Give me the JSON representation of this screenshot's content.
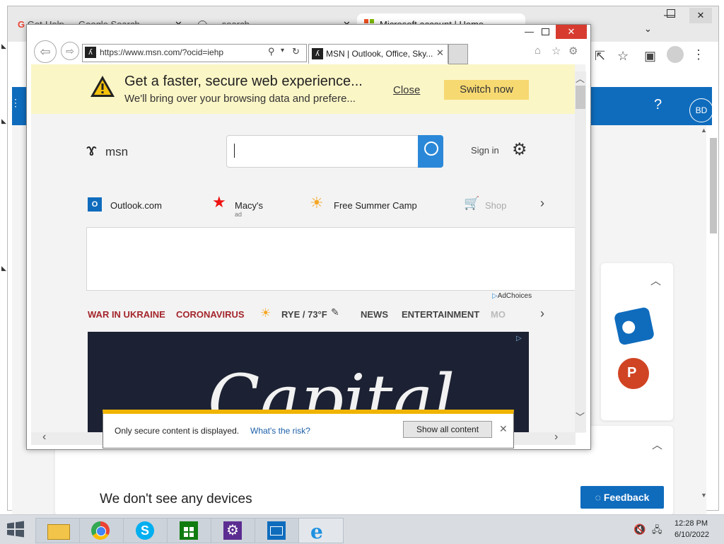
{
  "chrome": {
    "tabs": [
      {
        "label": "Get-Help … Google Search"
      },
      {
        "label": "… search …"
      },
      {
        "label": "Microsoft account | Home"
      }
    ],
    "help_label": "?",
    "avatar_initials": "BD",
    "devices_title": "We don't see any devices",
    "feedback_label": "Feedback"
  },
  "ie": {
    "address": "https://www.msn.com/?ocid=iehp",
    "tab_title": "MSN | Outlook, Office, Sky...",
    "yellow_bar": {
      "title": "Get a faster, secure web experience...",
      "subtitle": "We'll bring over your browsing data and prefere...",
      "close_label": "Close",
      "switch_label": "Switch now"
    },
    "msn": {
      "logo_text": "msn",
      "signin_label": "Sign in",
      "quick_links": [
        {
          "label": "Outlook.com"
        },
        {
          "label": "Macy's",
          "sublabel": "ad"
        },
        {
          "label": "Free Summer Camp"
        },
        {
          "label": "Shop"
        }
      ],
      "adchoices_label": "AdChoices",
      "nav_categories": [
        {
          "label": "WAR IN UKRAINE",
          "color": "#a4262c"
        },
        {
          "label": "CORONAVIRUS",
          "color": "#a4262c"
        },
        {
          "label": "RYE / 73°F",
          "color": "#444444"
        },
        {
          "label": "NEWS",
          "color": "#444444"
        },
        {
          "label": "ENTERTAINMENT",
          "color": "#444444"
        },
        {
          "label": "MO",
          "color": "#bbbbbb"
        }
      ],
      "hero_text": "Capital"
    },
    "security_bar": {
      "message": "Only secure content is displayed.",
      "risk_link": "What's the risk?",
      "show_all_label": "Show all content"
    }
  },
  "taskbar": {
    "apps": [
      {
        "name": "file-explorer"
      },
      {
        "name": "chrome"
      },
      {
        "name": "skype"
      },
      {
        "name": "store"
      },
      {
        "name": "settings"
      },
      {
        "name": "mail"
      },
      {
        "name": "internet-explorer"
      }
    ],
    "time": "12:28 PM",
    "date": "6/10/2022"
  },
  "colors": {
    "accent_blue": "#0f6cbd",
    "ie_search_blue": "#2b88d8",
    "yellow_bar": "#fbf6c6",
    "switch_button": "#f7d972",
    "warning_amber": "#f0b400",
    "news_red": "#a4262c"
  }
}
